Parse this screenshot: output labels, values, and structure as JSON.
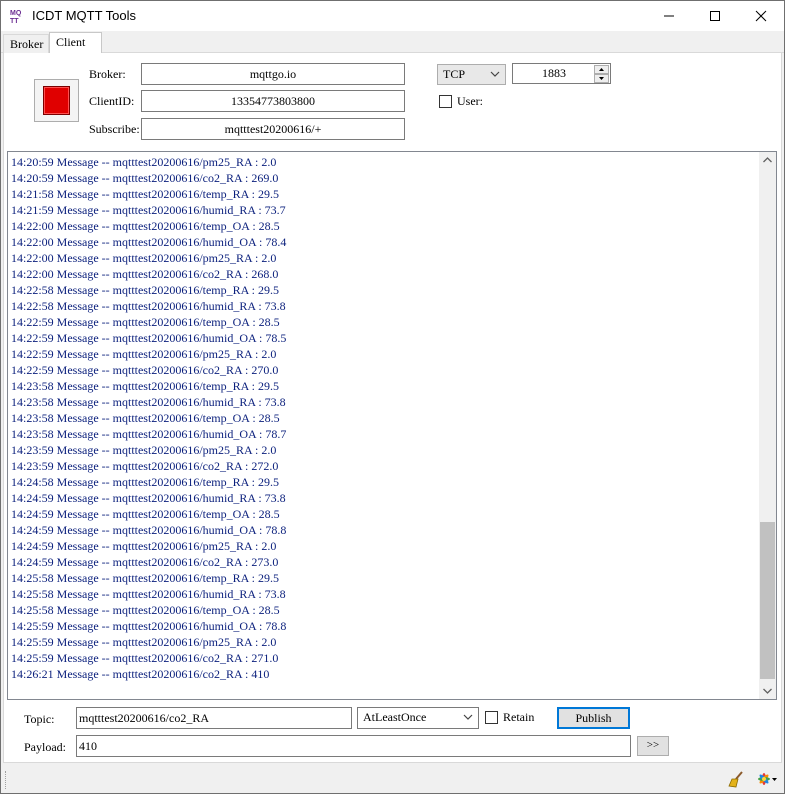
{
  "window": {
    "title": "ICDT MQTT Tools",
    "icon_name": "mqtt-app-icon",
    "controls": [
      "minimize-icon",
      "maximize-icon",
      "close-icon"
    ]
  },
  "tabs": [
    {
      "label": "Broker",
      "active": false
    },
    {
      "label": "Client",
      "active": true
    }
  ],
  "connection": {
    "connect_button_color": "#e00000",
    "broker_label": "Broker:",
    "broker_value": "mqttgo.io",
    "clientid_label": "ClientID:",
    "clientid_value": "13354773803800",
    "subscribe_label": "Subscribe:",
    "subscribe_value": "mqtttest20200616/+",
    "protocol_selected": "TCP",
    "port_value": "1883",
    "user_label": "User:",
    "user_checked": false
  },
  "log": {
    "text_color": "#0a1f7c",
    "lines": [
      "14:20:59 Message -- mqtttest20200616/pm25_RA : 2.0",
      "14:20:59 Message -- mqtttest20200616/co2_RA : 269.0",
      "14:21:58 Message -- mqtttest20200616/temp_RA : 29.5",
      "14:21:59 Message -- mqtttest20200616/humid_RA : 73.7",
      "14:22:00 Message -- mqtttest20200616/temp_OA : 28.5",
      "14:22:00 Message -- mqtttest20200616/humid_OA : 78.4",
      "14:22:00 Message -- mqtttest20200616/pm25_RA : 2.0",
      "14:22:00 Message -- mqtttest20200616/co2_RA : 268.0",
      "14:22:58 Message -- mqtttest20200616/temp_RA : 29.5",
      "14:22:58 Message -- mqtttest20200616/humid_RA : 73.8",
      "14:22:59 Message -- mqtttest20200616/temp_OA : 28.5",
      "14:22:59 Message -- mqtttest20200616/humid_OA : 78.5",
      "14:22:59 Message -- mqtttest20200616/pm25_RA : 2.0",
      "14:22:59 Message -- mqtttest20200616/co2_RA : 270.0",
      "14:23:58 Message -- mqtttest20200616/temp_RA : 29.5",
      "14:23:58 Message -- mqtttest20200616/humid_RA : 73.8",
      "14:23:58 Message -- mqtttest20200616/temp_OA : 28.5",
      "14:23:58 Message -- mqtttest20200616/humid_OA : 78.7",
      "14:23:59 Message -- mqtttest20200616/pm25_RA : 2.0",
      "14:23:59 Message -- mqtttest20200616/co2_RA : 272.0",
      "14:24:58 Message -- mqtttest20200616/temp_RA : 29.5",
      "14:24:59 Message -- mqtttest20200616/humid_RA : 73.8",
      "14:24:59 Message -- mqtttest20200616/temp_OA : 28.5",
      "14:24:59 Message -- mqtttest20200616/humid_OA : 78.8",
      "14:24:59 Message -- mqtttest20200616/pm25_RA : 2.0",
      "14:24:59 Message -- mqtttest20200616/co2_RA : 273.0",
      "14:25:58 Message -- mqtttest20200616/temp_RA : 29.5",
      "14:25:58 Message -- mqtttest20200616/humid_RA : 73.8",
      "14:25:58 Message -- mqtttest20200616/temp_OA : 28.5",
      "14:25:59 Message -- mqtttest20200616/humid_OA : 78.8",
      "14:25:59 Message -- mqtttest20200616/pm25_RA : 2.0",
      "14:25:59 Message -- mqtttest20200616/co2_RA : 271.0",
      "14:26:21 Message -- mqtttest20200616/co2_RA : 410"
    ]
  },
  "publish": {
    "topic_label": "Topic:",
    "topic_value": "mqtttest20200616/co2_RA",
    "qos_selected": "AtLeastOnce",
    "retain_label": "Retain",
    "retain_checked": false,
    "publish_label": "Publish",
    "payload_label": "Payload:",
    "payload_value": "410",
    "more_label": ">>"
  },
  "statusbar": {
    "icons": [
      "broom-icon",
      "color-wheel-icon"
    ]
  }
}
